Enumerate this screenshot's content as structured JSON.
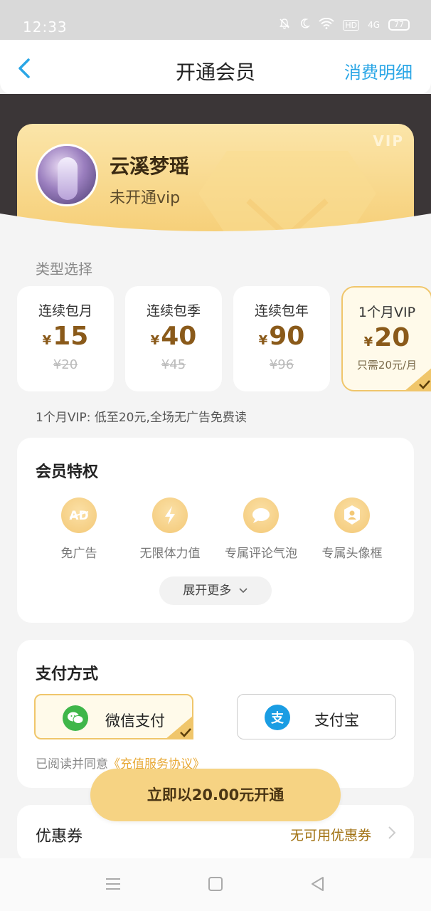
{
  "status_bar": {
    "time": "12:33",
    "battery": "77",
    "hd": "HD",
    "network": "4G"
  },
  "header": {
    "title": "开通会员",
    "right_link": "消费明细"
  },
  "vip_card": {
    "tag": "VIP",
    "username": "云溪梦瑶",
    "status": "未开通vip"
  },
  "plans_section": {
    "label": "类型选择",
    "plans": [
      {
        "name": "连续包月",
        "currency": "¥",
        "price": "15",
        "old_price": "¥20"
      },
      {
        "name": "连续包季",
        "currency": "¥",
        "price": "40",
        "old_price": "¥45"
      },
      {
        "name": "连续包年",
        "currency": "¥",
        "price": "90",
        "old_price": "¥96"
      },
      {
        "name": "1个月VIP",
        "currency": "¥",
        "price": "20",
        "note": "只需20元/月",
        "selected": true
      }
    ],
    "note": "1个月VIP: 低至20元,全场无广告免费读"
  },
  "privileges": {
    "title": "会员特权",
    "items": [
      {
        "label": "免广告",
        "icon": "ad-icon"
      },
      {
        "label": "无限体力值",
        "icon": "lightning-icon"
      },
      {
        "label": "专属评论气泡",
        "icon": "chat-bubble-icon"
      },
      {
        "label": "专属头像框",
        "icon": "avatar-frame-icon"
      }
    ],
    "expand_label": "展开更多"
  },
  "payment": {
    "title": "支付方式",
    "options": [
      {
        "label": "微信支付",
        "icon": "wechat-icon",
        "selected": true
      },
      {
        "label": "支付宝",
        "icon": "alipay-icon",
        "selected": false
      }
    ],
    "agree_prefix": "已阅读并同意",
    "agree_link": "《充值服务协议》"
  },
  "cta": {
    "label": "立即以20.00元开通"
  },
  "coupon": {
    "title": "优惠券",
    "value": "无可用优惠券"
  },
  "colors": {
    "accent_gold": "#f6d383",
    "link_blue": "#2aa6e6",
    "price_brown": "#8a5a1a"
  }
}
